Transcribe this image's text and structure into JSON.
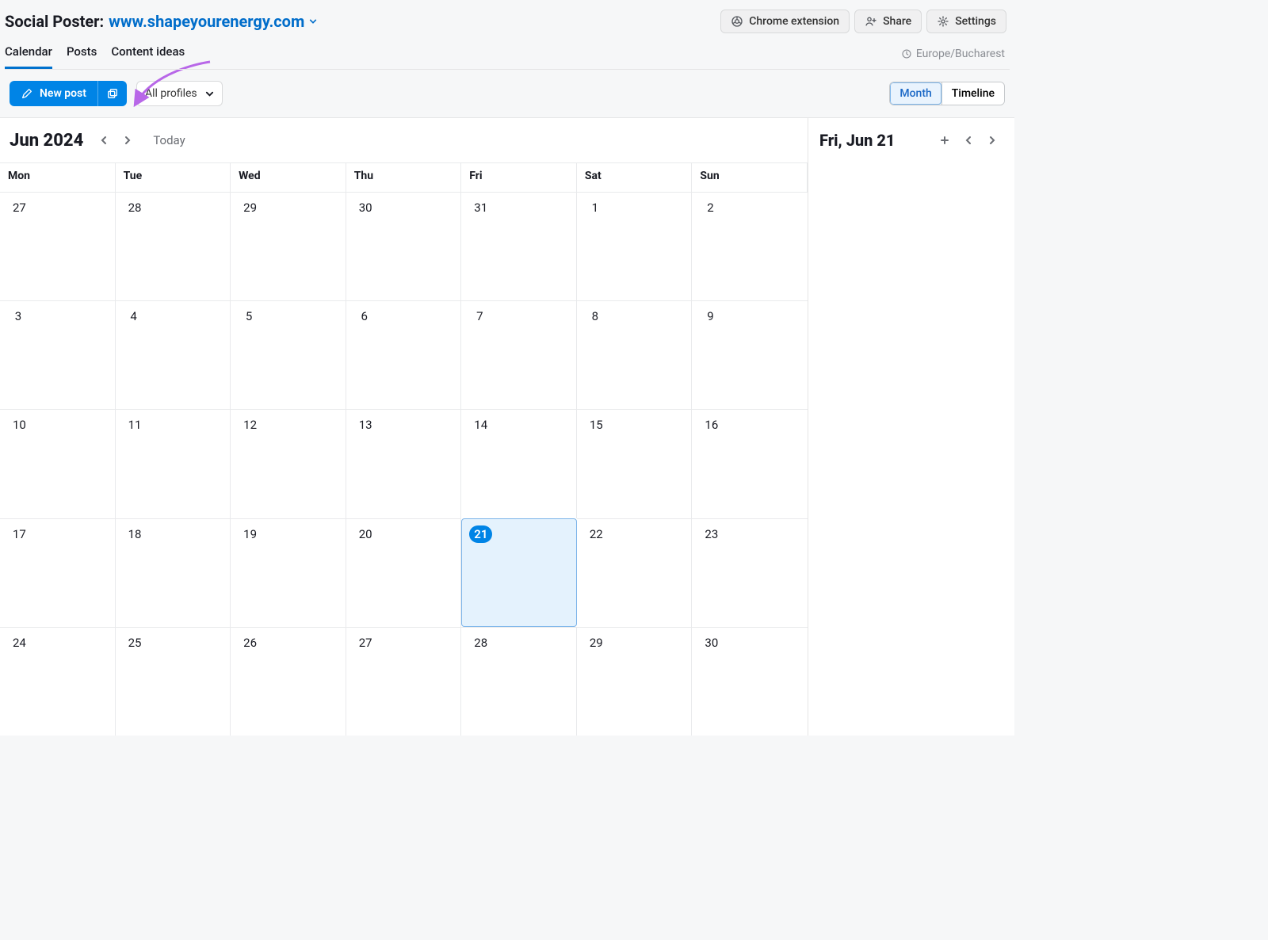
{
  "header": {
    "app_title": "Social Poster:",
    "domain": "www.shapeyourenergy.com",
    "buttons": {
      "extension": "Chrome extension",
      "share": "Share",
      "settings": "Settings"
    }
  },
  "tabs": {
    "items": [
      "Calendar",
      "Posts",
      "Content ideas"
    ],
    "active_index": 0
  },
  "timezone": "Europe/Bucharest",
  "toolbar": {
    "new_post": "New post",
    "profiles": "All profiles",
    "view_month": "Month",
    "view_timeline": "Timeline",
    "active_view": "month"
  },
  "calendar": {
    "title": "Jun 2024",
    "today_label": "Today",
    "day_headers": [
      "Mon",
      "Tue",
      "Wed",
      "Thu",
      "Fri",
      "Sat",
      "Sun"
    ],
    "weeks": [
      [
        {
          "day": "27",
          "other_month": true
        },
        {
          "day": "28",
          "other_month": true
        },
        {
          "day": "29",
          "other_month": true
        },
        {
          "day": "30",
          "other_month": true
        },
        {
          "day": "31",
          "other_month": true
        },
        {
          "day": "1"
        },
        {
          "day": "2"
        }
      ],
      [
        {
          "day": "3"
        },
        {
          "day": "4"
        },
        {
          "day": "5"
        },
        {
          "day": "6"
        },
        {
          "day": "7"
        },
        {
          "day": "8"
        },
        {
          "day": "9"
        }
      ],
      [
        {
          "day": "10"
        },
        {
          "day": "11"
        },
        {
          "day": "12"
        },
        {
          "day": "13"
        },
        {
          "day": "14"
        },
        {
          "day": "15"
        },
        {
          "day": "16"
        }
      ],
      [
        {
          "day": "17"
        },
        {
          "day": "18"
        },
        {
          "day": "19"
        },
        {
          "day": "20"
        },
        {
          "day": "21",
          "selected": true
        },
        {
          "day": "22"
        },
        {
          "day": "23"
        }
      ],
      [
        {
          "day": "24"
        },
        {
          "day": "25"
        },
        {
          "day": "26"
        },
        {
          "day": "27"
        },
        {
          "day": "28"
        },
        {
          "day": "29"
        },
        {
          "day": "30"
        }
      ]
    ]
  },
  "side_panel": {
    "selected_date": "Fri, Jun 21"
  }
}
